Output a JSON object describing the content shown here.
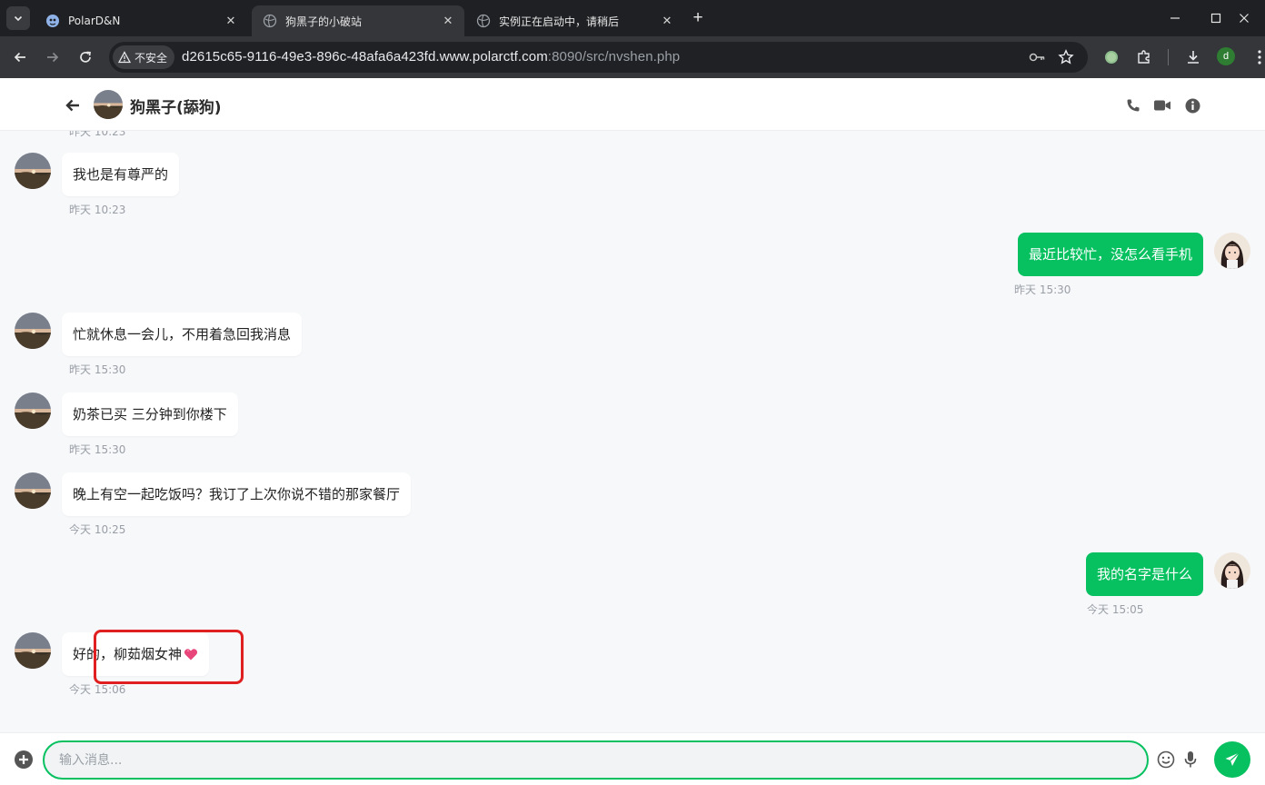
{
  "browser": {
    "tabs": [
      {
        "title": "PolarD&N",
        "active": false
      },
      {
        "title": "狗黑子的小破站",
        "active": true
      },
      {
        "title": "实例正在启动中，请稍后",
        "active": false
      }
    ],
    "security_label": "不安全",
    "url_host": "d2615c65-9116-49e3-896c-48afa6a423fd.www.polarctf.com",
    "url_rest": ":8090/src/nvshen.php",
    "profile_initial": "d"
  },
  "chat": {
    "contact_name": "狗黑子(舔狗)",
    "clipped_timestamp": "昨天 10:23",
    "messages": [
      {
        "side": "in",
        "text": "我也是有尊严的",
        "time": "昨天 10:23"
      },
      {
        "side": "out",
        "text": "最近比较忙，没怎么看手机",
        "time": "昨天 15:30"
      },
      {
        "side": "in",
        "text": "忙就休息一会儿，不用着急回我消息",
        "time": "昨天 15:30"
      },
      {
        "side": "in",
        "text": "奶茶已买 三分钟到你楼下",
        "time": "昨天 15:30"
      },
      {
        "side": "in",
        "text": "晚上有空一起吃饭吗？我订了上次你说不错的那家餐厅",
        "time": "今天 10:25"
      },
      {
        "side": "out",
        "text": "我的名字是什么",
        "time": "今天 15:05"
      },
      {
        "side": "in",
        "text": "好的，柳茹烟女神",
        "time": "今天 15:06",
        "emoji": "pink-heart"
      }
    ],
    "input_placeholder": "输入消息..."
  },
  "colors": {
    "accent": "#07c160",
    "highlight": "#e02020"
  }
}
